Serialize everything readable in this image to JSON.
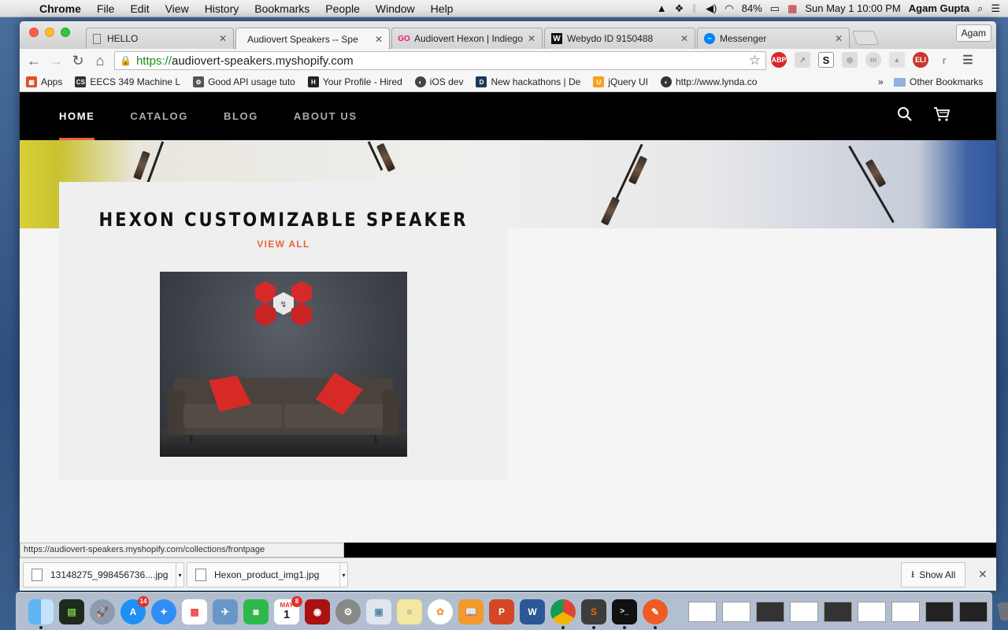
{
  "menubar": {
    "app_name": "Chrome",
    "menus": [
      "File",
      "Edit",
      "View",
      "History",
      "Bookmarks",
      "People",
      "Window",
      "Help"
    ],
    "battery": "84%",
    "datetime": "Sun May 1  10:00 PM",
    "user": "Agam Gupta"
  },
  "browser": {
    "tabs": [
      {
        "title": "HELLO",
        "favicon": "document-icon"
      },
      {
        "title": "Audiovert Speakers -- Spe",
        "favicon": "none",
        "active": true
      },
      {
        "title": "Audiovert Hexon | Indiegog",
        "favicon": "indiegogo-icon"
      },
      {
        "title": "Webydo ID 9150488",
        "favicon": "webydo-icon"
      },
      {
        "title": "Messenger",
        "favicon": "messenger-icon"
      }
    ],
    "profile": "Agam",
    "url_protocol": "https://",
    "url_host": "audiovert-speakers.myshopify.com",
    "bookmarks": [
      {
        "label": "Apps",
        "icon": "apps-grid-icon",
        "color": "#e44d26"
      },
      {
        "label": "EECS 349 Machine L",
        "icon": "cs-icon",
        "color": "#333333"
      },
      {
        "label": "Good API usage tuto",
        "icon": "api-icon",
        "color": "#555555"
      },
      {
        "label": "Your Profile - Hired",
        "icon": "hired-icon",
        "color": "#222222"
      },
      {
        "label": "iOS dev",
        "icon": "ios-icon",
        "color": "#444444"
      },
      {
        "label": "New hackathons | De",
        "icon": "devpost-icon",
        "color": "#1b3a57"
      },
      {
        "label": "jQuery UI",
        "icon": "jquery-icon",
        "color": "#f7a21b"
      },
      {
        "label": "http://www.lynda.co",
        "icon": "lynda-icon",
        "color": "#333333"
      }
    ],
    "bookmarks_overflow": "»",
    "other_bookmarks": "Other Bookmarks"
  },
  "site": {
    "nav": [
      "HOME",
      "CATALOG",
      "BLOG",
      "ABOUT US"
    ],
    "active_nav": "HOME",
    "feature_title": "HEXON CUSTOMIZABLE SPEAKER",
    "view_all": "VIEW ALL",
    "accent_color": "#e7643b"
  },
  "status_url": "https://audiovert-speakers.myshopify.com/collections/frontpage",
  "downloads": {
    "items": [
      "13148275_998456736....jpg",
      "Hexon_product_img1.jpg"
    ],
    "show_all": "Show All"
  },
  "dock": {
    "calendar_month": "MAY",
    "calendar_day": "1",
    "appstore_badge": "14",
    "calendar_badge": "8"
  }
}
